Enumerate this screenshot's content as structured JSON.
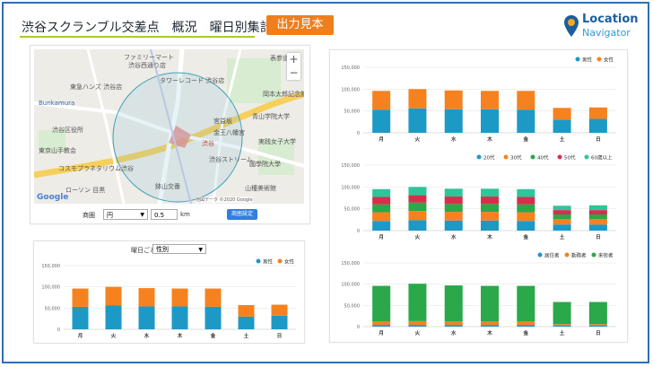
{
  "header": {
    "title": "渋谷スクランブル交差点　概況　曜日別集計",
    "badge": "出力見本",
    "logo_line1": "Location",
    "logo_line2": "Navigator"
  },
  "map": {
    "labels": [
      "ファミリーマート",
      "渋谷西通り店",
      "表参道",
      "東急ハンズ 渋谷店",
      "Bunkamura",
      "渋谷",
      "東京山手教会",
      "渋谷区役所",
      "コスモプラネタリウム渋谷",
      "ローソン 目黒",
      "鉢山交番",
      "山種美術館",
      "國學院大學",
      "実践女子大学",
      "青山学院大学",
      "岡本太郎記念館",
      "渋谷ストリーム",
      "タワーレコード 渋谷店",
      "宮益坂",
      "金王八幡宮"
    ],
    "footer": "地図データ ©2020 Google",
    "zoom_in": "+",
    "zoom_out": "−",
    "google": "Google"
  },
  "controls": {
    "range_label": "商圏",
    "range_shape": "円",
    "range_value": "0.5",
    "range_unit": "km",
    "apply_button": "商圏設定",
    "group_label": "曜日ごと",
    "group_value": "性別"
  },
  "charts": {
    "days": [
      "月",
      "火",
      "水",
      "木",
      "金",
      "土",
      "日"
    ],
    "yticks": [
      "0",
      "50,000",
      "100,000",
      "150,000"
    ],
    "gender": {
      "legend": [
        "男性",
        "女性"
      ],
      "colors": [
        "#1d99c6",
        "#f5821f"
      ],
      "male": [
        53000,
        56000,
        54000,
        54000,
        53000,
        30000,
        32000
      ],
      "female": [
        43000,
        44000,
        43000,
        42000,
        43000,
        27000,
        26000
      ]
    },
    "age": {
      "legend": [
        "20代",
        "30代",
        "40代",
        "50代",
        "60歳以上"
      ],
      "colors": [
        "#1d99c6",
        "#f5821f",
        "#2aa84a",
        "#d62f4b",
        "#2fc59a"
      ],
      "series": [
        [
          22000,
          24000,
          23000,
          23000,
          22000,
          14000,
          14000
        ],
        [
          20000,
          21000,
          20000,
          20000,
          20000,
          12000,
          12000
        ],
        [
          18000,
          19000,
          18000,
          18000,
          18000,
          11000,
          11000
        ],
        [
          17000,
          17000,
          17000,
          17000,
          17000,
          10000,
          10000
        ],
        [
          18000,
          19000,
          18000,
          18000,
          18000,
          10000,
          11000
        ]
      ]
    },
    "residence": {
      "legend": [
        "居住者",
        "勤務者",
        "来街者"
      ],
      "colors": [
        "#1d99c6",
        "#f5821f",
        "#2aa84a"
      ],
      "series": [
        [
          4000,
          4000,
          4000,
          4000,
          4000,
          3000,
          3000
        ],
        [
          8000,
          9000,
          8000,
          8000,
          8000,
          3000,
          3000
        ],
        [
          84000,
          88000,
          85000,
          84000,
          84000,
          52000,
          52000
        ]
      ]
    }
  }
}
